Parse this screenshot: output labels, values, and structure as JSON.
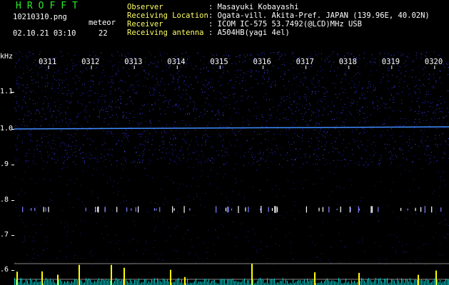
{
  "header": {
    "brand": "HROFFT",
    "filename": "10210310.png",
    "datetime": "02.10.21 03:10",
    "meteor_label": "meteor",
    "meteor_count": "22",
    "info": [
      {
        "label": "Observer",
        "value": ": Masayuki Kobayashi"
      },
      {
        "label": "Receiving Location",
        "value": ": Ogata-vill. Akita-Pref. JAPAN (139.96E, 40.02N)"
      },
      {
        "label": "Receiver",
        "value": ": ICOM IC-575 53.7492(@LCD)MHz USB"
      },
      {
        "label": "Receiving antenna",
        "value": ": A504HB(yagi 4el)"
      }
    ]
  },
  "axis": {
    "unit": "kHz",
    "ticks": [
      "1.1",
      "1.0",
      ".9",
      ".8",
      ".7",
      ".6"
    ]
  },
  "time_marks": [
    "0311",
    "0312",
    "0313",
    "0314",
    "0315",
    "0316",
    "0317",
    "0318",
    "0319",
    "0320"
  ],
  "colors": {
    "background": "#000000",
    "noise": "#2a2ad0",
    "carrier": "#3f8cff",
    "brand": "#2ee82e",
    "label": "#ffff66",
    "echo": "#ffff00",
    "baseline": "#00e0e0"
  }
}
